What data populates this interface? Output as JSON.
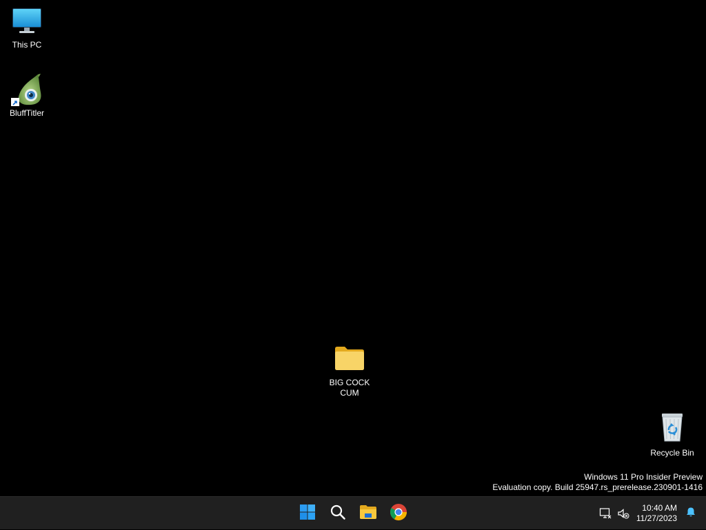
{
  "desktop": {
    "icons": [
      {
        "label": "This PC",
        "icon": "monitor-icon"
      },
      {
        "label": "BluffTitler",
        "icon": "blufftitler-icon"
      },
      {
        "label": "BIG COCK\nCUM",
        "icon": "folder-icon"
      },
      {
        "label": "Recycle Bin",
        "icon": "recycle-bin-icon"
      }
    ]
  },
  "watermark": {
    "line1": "Windows 11 Pro Insider Preview",
    "line2": "Evaluation copy. Build 25947.rs_prerelease.230901-1416"
  },
  "taskbar": {
    "apps": [
      {
        "name": "Start",
        "icon": "windows-start-icon"
      },
      {
        "name": "Search",
        "icon": "search-icon"
      },
      {
        "name": "File Explorer",
        "icon": "file-explorer-icon"
      },
      {
        "name": "Google Chrome",
        "icon": "chrome-icon"
      }
    ],
    "tray": {
      "time": "10:40 AM",
      "date": "11/27/2023",
      "icons": [
        "network-icon",
        "volume-muted-icon",
        "notification-bell-icon"
      ]
    }
  },
  "colors": {
    "desktop_bg": "#000000",
    "taskbar_bg": "#202020",
    "start_blue": "#2b9cf2",
    "folder_yellow": "#f6c846",
    "notification_blue": "#4cc2ff"
  }
}
